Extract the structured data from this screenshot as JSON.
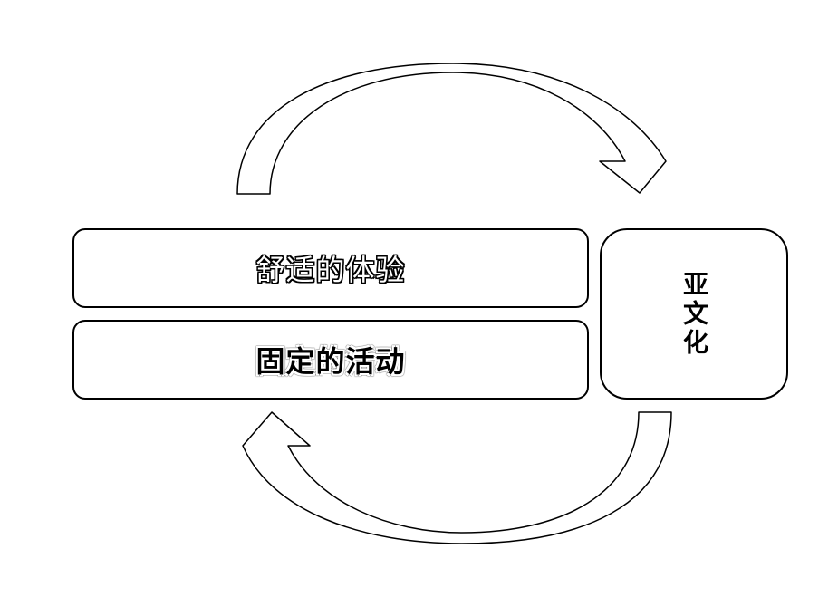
{
  "diagram": {
    "top_box_label": "舒适的体验",
    "bottom_box_label": "固定的活动",
    "right_box_label": "亚文化",
    "arrow_top": "cycle-arrow-left-to-right",
    "arrow_bottom": "cycle-arrow-right-to-left",
    "colors": {
      "stroke": "#000000",
      "fill": "#ffffff"
    }
  }
}
